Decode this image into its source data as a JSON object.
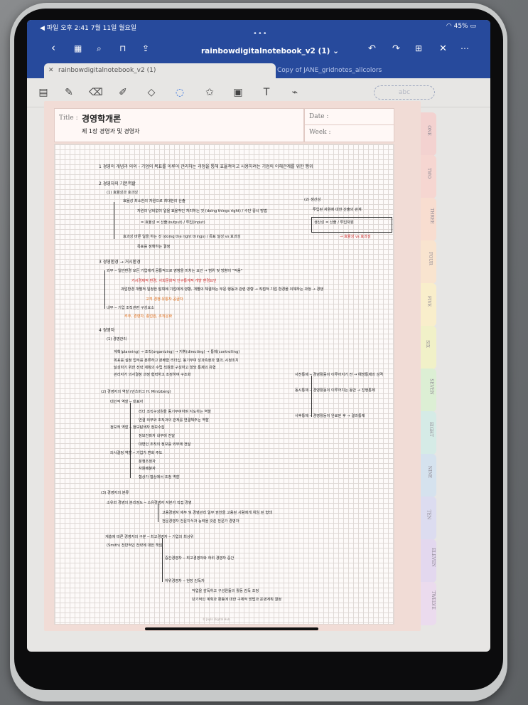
{
  "status_bar": {
    "back_app": "◀ 파일",
    "time": "오후 2:41",
    "date": "7월 11일 월요일",
    "battery": "45%"
  },
  "toolbar": {
    "doc_title": "rainbowdigitalnotebook_v2 (1)",
    "title_chevron": "⌄"
  },
  "tabs": [
    {
      "label": "rainbowdigitalnotebook_v2 (1)",
      "active": true
    },
    {
      "label": "Copy of JANE_gridnotes_allcolors",
      "active": false
    }
  ],
  "tools": {
    "lasso_hint": "abc"
  },
  "page": {
    "title_label": "Title :",
    "title_value": "경영학개론",
    "subtitle_value": "제 1장  경영과 및 경영자",
    "date_label": "Date :",
    "week_label": "Week :",
    "footer": "© Joyln Digital Hub"
  },
  "section_tabs": [
    {
      "label": "ONE",
      "color": "#f3d2d0"
    },
    {
      "label": "TWO",
      "color": "#f6d6d1"
    },
    {
      "label": "THREE",
      "color": "#f8ddd0"
    },
    {
      "label": "FOUR",
      "color": "#f9e4cf"
    },
    {
      "label": "FIVE",
      "color": "#f9eecb"
    },
    {
      "label": "SIX",
      "color": "#f1f1c8"
    },
    {
      "label": "SEVEN",
      "color": "#dcefd4"
    },
    {
      "label": "EIGHT",
      "color": "#d5ebe6"
    },
    {
      "label": "NINE",
      "color": "#d5e2ee"
    },
    {
      "label": "TEN",
      "color": "#dcdcf0"
    },
    {
      "label": "ELEVEN",
      "color": "#e3d8ef"
    },
    {
      "label": "TWELVE",
      "color": "#ebdbee"
    }
  ],
  "notes": {
    "s1": "1  경영의 개념과 의의  -  기업의 목표를 이루어 관리하는 과정을 통해 효율적이고 사용하려는 기업의 이해관계를 위한 행위",
    "s2": "2  경영자의 기본역할",
    "s2a": "(1) 효율성과 효과성",
    "s2a1": "효율성   최소한의 자원으로 최대한의 산출",
    "s2a2": "자원의 낭비없이 일을 효율적인 처리하는 것 (doing things right) / 수단 중시 방법",
    "s2a3": "= 효율성 =  산출(output) / 투입(input)",
    "s2a4": "효과성   바른 일을 하는 것 (doing the right things) / 목표 달성 vs 효과성",
    "s2a5": "목표를 정확하는 결정",
    "s2b": "(2) 생산성",
    "s2b1": "투입된 자원에 대한 산출의 관계",
    "s2b2": "생산성 =  산출 / 투입자원",
    "s2b3": "→ 효율성 vs 효과성",
    "s3": "3  경영환경   → 거시환경",
    "s3a": "외부 ─ 일반환경   모든 기업에게 공통적으로 영향을 미치는 요인 → 범위 및 방향이 \"적음\"",
    "s3b": "거시경제적 환경, 사회문화적 인구통계적 개방 환경요인",
    "s3c": "과업환경   개별적 일정한 발휘에 기업에게 영향, 개별의 해결하는 부문 행동과 관련 영향 → 직접적 기업 환경을 이해하는 과정 → 경쟁",
    "s3d": "고객 경쟁 유통자 공급자",
    "s3e": "내부 ─ 기업 조직관련 구성요소",
    "s3f": "주주, 경영자, 종업원, 조직문화",
    "s4": "4  경영자",
    "s4a": "(1) 경영관리",
    "s4a1": "계획(planning)   →   조직(organizing)   →   지휘(directing)   →   통제(controlling)",
    "s4a2": "목표를 설정   업무를 분류하고 분배함   리더십, 동기부여   성과측정과 결과, 시정조치",
    "s4a3": "달성하기 위한 전략 계획의 수립   직원을 구성하고 할당   통제의 유형",
    "s4a4": "관리자가 의사결정 과정   협력하고 조정하여 구조화",
    "s4c1": "사전통제 ─ 경영활동이 이루어지기 전 → 예방통제의 성격",
    "s4c2": "동시통제 ─ 경영활동이 이루어지는 동안 → 진행통제",
    "s4c3": "사후통제 ─ 경영활동이 완료된 후 → 결과통제",
    "s4b": "(2) 경영자의 역할 (민츠버그 H. Mintzberg)",
    "s4b1": "대인적 역할 ─ 대표자",
    "s4b2": "리더   조직구성원을 동기부여하며 지도하는 역할",
    "s4b3": "연결   외부와 조직과의 관계를 연결해주는 역할",
    "s4b4": "정보적 역할 ─ 정보탐색자   정보수집",
    "s4b5": "정보전파자   내부에 전달",
    "s4b6": "대변인   조직의 정보를 외부에 전달",
    "s4b7": "의사결정 역할 ─ 기업가   변화 주도",
    "s4b8": "분쟁조정자",
    "s4b9": "자원배분자",
    "s4b10": "협상가   협상에서 조정 역할",
    "s4d": "(3) 경영자의 분류",
    "s4d1": "소유와 경영의 분리정도 ─ 소유경영자   자본가 직접 경영",
    "s4d2": "고용경영자   재무 및 경영관리 일부 권한을 고용된 사람에게 위임 된 형태",
    "s4d3": "전문경영자   전문지식과 능력을 갖춘 전문가 경영자",
    "s4e": "계층에 따른 경영자의 구분 ─ 최고경영자 ─ 기업의 최상위",
    "s4e1": "(Smith)   전반적인 전략에 대한 책임",
    "s4e2": "중간경영자 ─ 최고경영자와 하위 경영자 중간",
    "s4e3": "하위경영자 ─ 현장 감독자",
    "s4e4": "작업을 감독하고 구성원들의 활동 감독 조정",
    "s4e5": "단기적인 계획과 활동에 대한 구체적 방법과 운영계획 결정"
  }
}
